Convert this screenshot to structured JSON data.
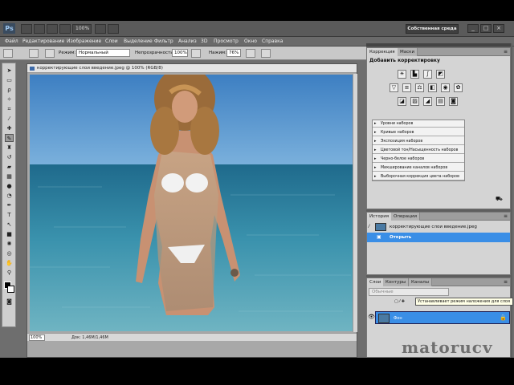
{
  "appbar": {
    "zoom": "100%",
    "workspace": "Собственная среда"
  },
  "menu": [
    "Файл",
    "Редактирование",
    "Изображение",
    "Слои",
    "Выделение",
    "Фильтр",
    "Анализ",
    "3D",
    "Просмотр",
    "Окно",
    "Справка"
  ],
  "options": {
    "mode_label": "Режим:",
    "mode_value": "Нормальный",
    "opacity_label": "Непрозрачность:",
    "opacity_value": "100%",
    "press_label": "Нажим:",
    "press_value": "76%"
  },
  "document": {
    "title": "корректирующие слои введение.jpeg @ 100% (RGB/8)",
    "zoom": "100%",
    "info": "Док: 1,46M/1,46M"
  },
  "adjustments": {
    "tab_active": "Коррекция",
    "tab_other": "Маски",
    "title": "Добавить корректировку",
    "presets": [
      "Уровни наборов",
      "Кривые наборов",
      "Экспозиция наборов",
      "Цветовой тон/Насыщенность наборов",
      "Черно-белое наборов",
      "Микширование каналов наборов",
      "Выборочная коррекция цвета наборов"
    ]
  },
  "history": {
    "tab_active": "История",
    "tab_other": "Операции",
    "snapshot": "корректирующие слои введение.jpeg",
    "step": "Открыть"
  },
  "layers": {
    "tab_active": "Слои",
    "tab2": "Контуры",
    "tab3": "Каналы",
    "blend": "Обычные",
    "tooltip": "Устанавливает режим наложения для слоя",
    "layer_name": "Фон"
  },
  "watermark": "matorucv"
}
